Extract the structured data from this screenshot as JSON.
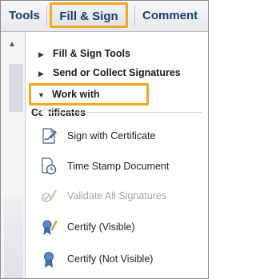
{
  "tabs": {
    "tools": "Tools",
    "fill_sign": "Fill & Sign",
    "comment": "Comment"
  },
  "sections": [
    {
      "label": "Fill & Sign Tools",
      "expanded": false
    },
    {
      "label": "Send or Collect Signatures",
      "expanded": false
    },
    {
      "label": "Work with Certificates",
      "expanded": true
    }
  ],
  "items": [
    {
      "label": "Sign with Certificate",
      "icon": "sign-certificate-icon",
      "enabled": true
    },
    {
      "label": "Time Stamp Document",
      "icon": "time-stamp-icon",
      "enabled": true
    },
    {
      "label": "Validate All Signatures",
      "icon": "validate-signatures-icon",
      "enabled": false
    },
    {
      "label": "Certify (Visible)",
      "icon": "certify-visible-icon",
      "enabled": true
    },
    {
      "label": "Certify (Not Visible)",
      "icon": "certify-not-visible-icon",
      "enabled": true
    }
  ],
  "colors": {
    "highlight": "#f5a623",
    "tab_text": "#1f3d6b",
    "disabled_text": "#a6a6a6"
  }
}
